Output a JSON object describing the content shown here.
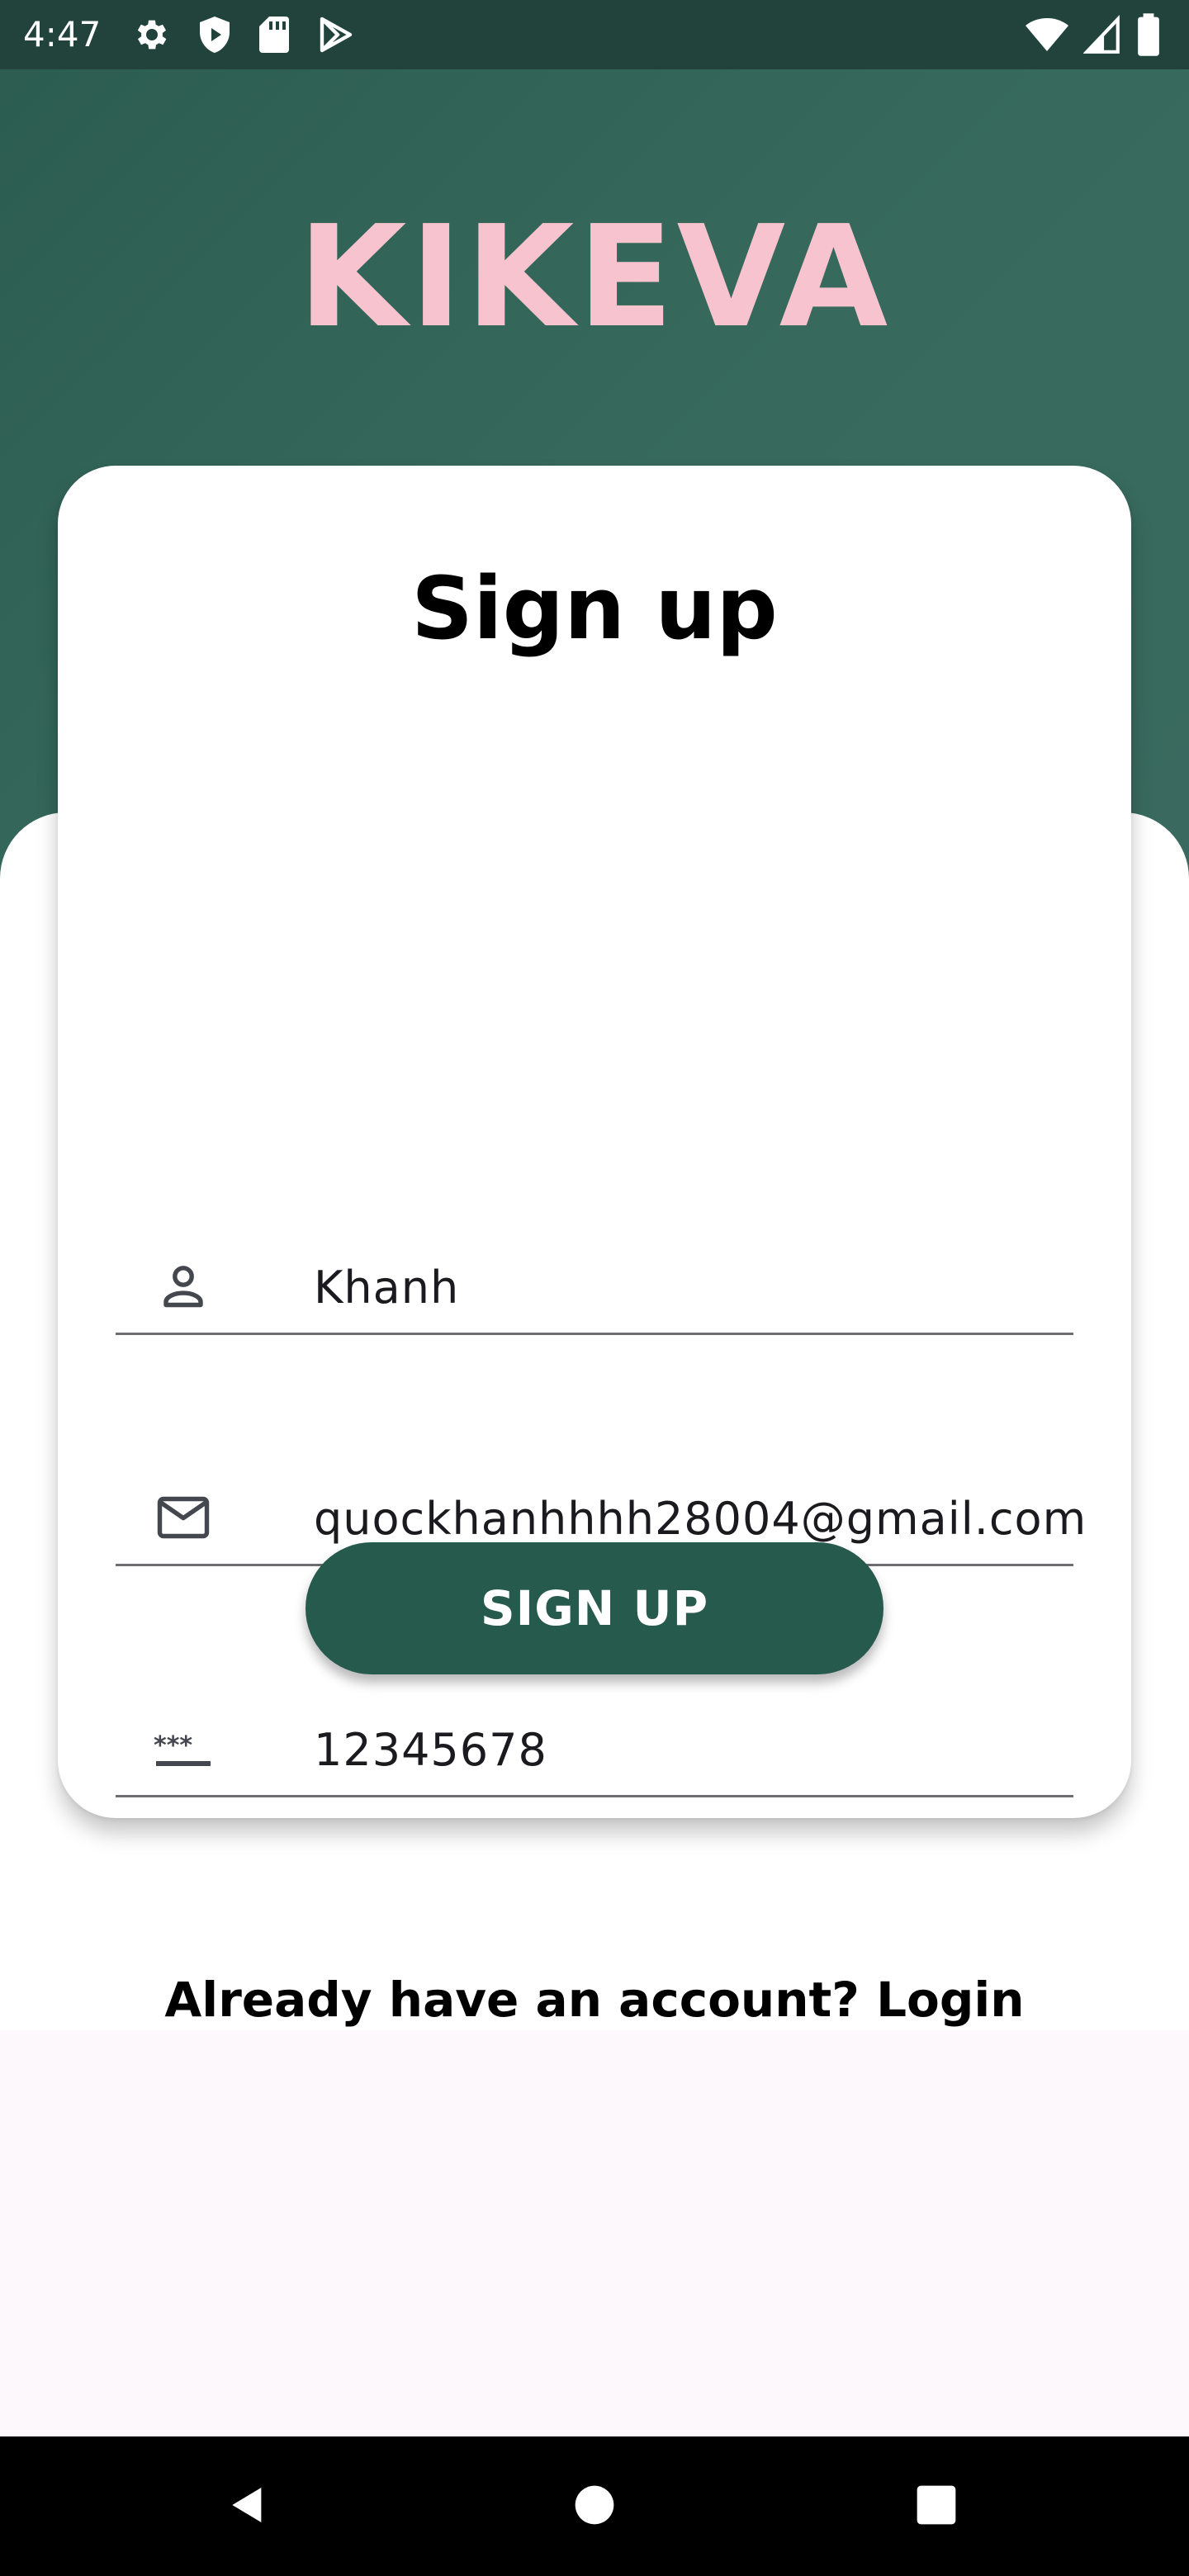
{
  "status_bar": {
    "time": "4:47",
    "left_icons": [
      "gear-icon",
      "shield-icon",
      "sd-card-icon",
      "play-store-icon"
    ],
    "right_icons": [
      "wifi-icon",
      "cellular-signal-icon",
      "battery-icon"
    ]
  },
  "brand": {
    "title": "KIKEVA",
    "color": "#f7c3cf"
  },
  "form": {
    "title": "Sign up",
    "fields": [
      {
        "icon": "person-icon",
        "value": "Khanh"
      },
      {
        "icon": "mail-icon",
        "value": "quockhanhhhh28004@gmail.com"
      },
      {
        "icon": "password-icon",
        "value": "12345678"
      }
    ],
    "submit_label": "SIGN UP"
  },
  "footer": {
    "login_prompt": "Already have an account? Login"
  },
  "nav_bar": {
    "buttons": [
      "back-icon",
      "home-icon",
      "recents-icon"
    ]
  },
  "colors": {
    "primary_green": "#265a4d",
    "header_green": "#376a5d",
    "brand_pink": "#f7c3cf",
    "background": "#fdf8fc"
  }
}
